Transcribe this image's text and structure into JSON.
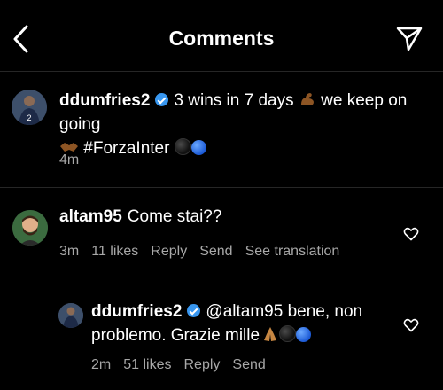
{
  "header": {
    "title": "Comments"
  },
  "caption": {
    "username": "ddumfries2",
    "text_part1": "3 wins in 7 days",
    "text_part2": "we keep on going",
    "hashtag": "#ForzaInter",
    "time": "4m"
  },
  "comments": [
    {
      "username": "altam95",
      "text": "Come stai??",
      "time": "3m",
      "likes": "11 likes",
      "reply": "Reply",
      "send": "Send",
      "translate": "See translation"
    },
    {
      "username": "ddumfries2",
      "text_line1": "@altam95 bene, non",
      "text_line2": "problemo. Grazie mille",
      "time": "2m",
      "likes": "51 likes",
      "reply": "Reply",
      "send": "Send"
    }
  ],
  "colors": {
    "background": "#000000",
    "text": "#ffffff",
    "meta_text": "#a8a8a8",
    "verified_badge": "#3897f0",
    "divider": "#262626"
  },
  "icons": [
    "back-arrow-icon",
    "share-direct-icon",
    "verified-badge-icon",
    "heart-icon"
  ]
}
